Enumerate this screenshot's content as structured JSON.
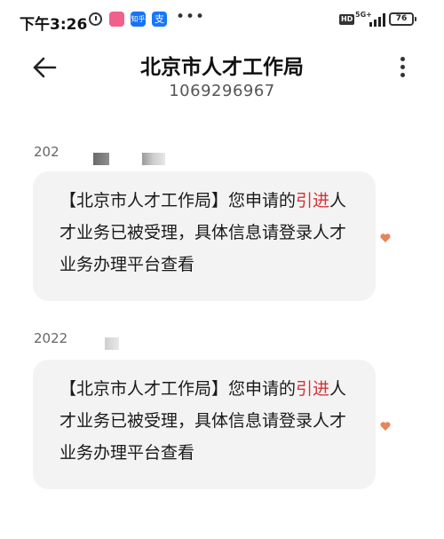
{
  "status_bar": {
    "time": "下午3:26",
    "app_icons": [
      "pink-app-icon",
      "zhihu-icon",
      "alipay-icon"
    ],
    "app_icon_labels": [
      "",
      "知乎",
      "支"
    ],
    "more": "•••",
    "hd": "HD",
    "network": "5G+",
    "battery": "76"
  },
  "header": {
    "title": "北京市人才工作局",
    "number": "1069296967"
  },
  "messages": [
    {
      "timestamp": "202",
      "parts": [
        "【北京市人才工作局】您申请的",
        "引进",
        "人才业务已被受理，具体信息请登录人才业务办理平台查看"
      ]
    },
    {
      "timestamp": "2022",
      "parts": [
        "【北京市人才工作局】您申请的",
        "引进",
        "人才业务已被受理，具体信息请登录人才业务办理平台查看"
      ]
    }
  ],
  "colors": {
    "highlight": "#d13438",
    "bubble": "#f3f3f3",
    "heart": "#e8845a"
  }
}
